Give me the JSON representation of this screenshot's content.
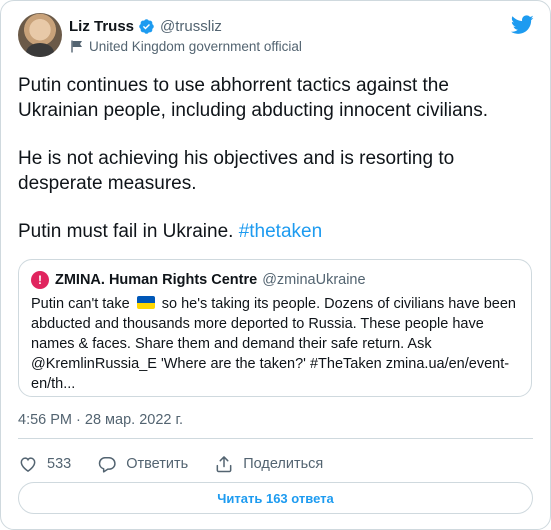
{
  "author": {
    "display_name": "Liz Truss",
    "handle": "@trussliz",
    "label": "United Kingdom government official"
  },
  "icons": {
    "verified": "verified-badge-icon",
    "label_flag": "flag-icon",
    "logo": "twitter-bird-icon",
    "like": "heart-icon",
    "reply": "reply-bubble-icon",
    "share": "share-upload-icon"
  },
  "tweet": {
    "para1": "Putin continues to use abhorrent tactics against the Ukrainian people, including abducting innocent civilians.",
    "para2": "He is not achieving his objectives and is resorting to desperate measures.",
    "para3_text": "Putin must fail in Ukraine. ",
    "para3_hashtag": "#thetaken"
  },
  "quote": {
    "avatar_glyph": "!",
    "name": "ZMINA. Human Rights Centre",
    "handle": "@zminaUkraine",
    "text_before_flag": "Putin can't take",
    "text_after_flag": "so he's taking its people. Dozens of civilians have been abducted and thousands more deported to Russia. These people have names & faces. Share them and demand their safe return. Ask @KremlinRussia_E 'Where are the taken?' #TheTaken zmina.ua/en/event-en/th..."
  },
  "timestamp": "4:56 PM · 28 мар. 2022 г.",
  "actions": {
    "like_count": "533",
    "reply_label": "Ответить",
    "share_label": "Поделиться"
  },
  "read_replies_label": "Читать 163 ответа",
  "colors": {
    "accent": "#1d9bf0",
    "text": "#0f1419",
    "secondary": "#536471",
    "border": "#cfd9de",
    "ua_blue": "#0057b7",
    "ua_yellow": "#ffd700"
  }
}
